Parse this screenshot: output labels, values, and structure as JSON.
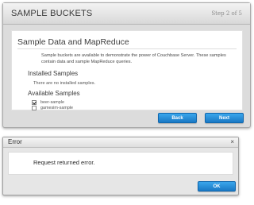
{
  "wizard": {
    "title": "SAMPLE BUCKETS",
    "step": "Step 2 of 5",
    "section_title": "Sample Data and MapReduce",
    "intro_text": "Sample buckets are available to demonstrate the power of Couchbase Server. These samples contain data and sample MapReduce queries.",
    "installed_title": "Installed Samples",
    "no_installed_text": "There are no installed samples.",
    "available_title": "Available Samples",
    "samples": [
      {
        "label": "beer-sample",
        "checked": true
      },
      {
        "label": "gamesim-sample",
        "checked": false
      }
    ],
    "back_label": "Back",
    "next_label": "Next"
  },
  "error_dialog": {
    "title": "Error",
    "close_glyph": "×",
    "message": "Request returned error.",
    "ok_label": "OK"
  },
  "colors": {
    "primary_button": "#1a79c4",
    "dialog_background": "#dcdcdc"
  }
}
